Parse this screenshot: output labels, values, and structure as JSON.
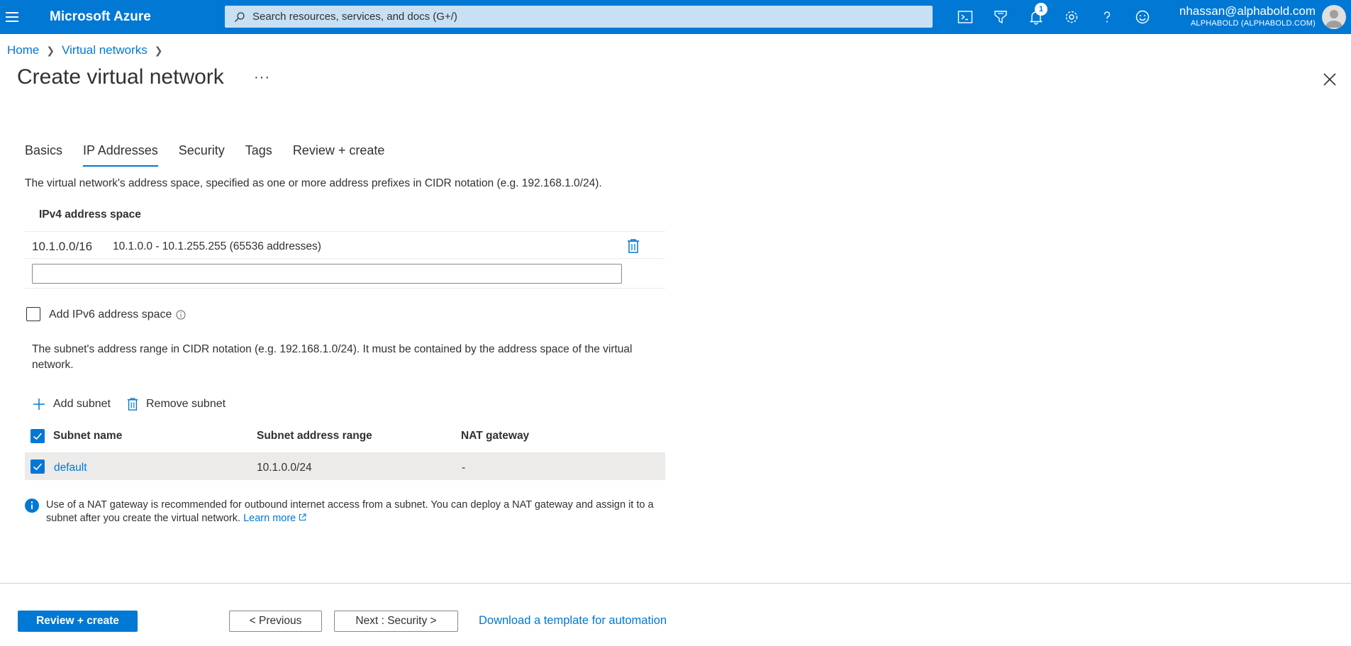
{
  "topbar": {
    "brand": "Microsoft Azure",
    "search_placeholder": "Search resources, services, and docs (G+/)",
    "notification_count": "1",
    "user_email": "nhassan@alphabold.com",
    "tenant": "ALPHABOLD (ALPHABOLD.COM)",
    "icons": [
      "cloud-shell-icon",
      "directory-filter-icon",
      "bell-icon",
      "gear-icon",
      "help-icon",
      "feedback-icon"
    ]
  },
  "breadcrumb": [
    "Home",
    "Virtual networks"
  ],
  "page": {
    "title": "Create virtual network",
    "ellipsis": "···"
  },
  "tabs": [
    "Basics",
    "IP Addresses",
    "Security",
    "Tags",
    "Review + create"
  ],
  "active_tab": "IP Addresses",
  "ip_addresses": {
    "description": "The virtual network's address space, specified as one or more address prefixes in CIDR notation (e.g. 192.168.1.0/24).",
    "ipv4_header": "IPv4 address space",
    "prefix": "10.1.0.0/16",
    "range": "10.1.0.0 - 10.1.255.255 (65536 addresses)",
    "new_prefix_value": "",
    "ipv6_label": "Add IPv6 address space",
    "ipv6_checked": false,
    "subnet_description": "The subnet's address range in CIDR notation (e.g. 192.168.1.0/24). It must be contained by the address space of the virtual network.",
    "add_subnet": "Add subnet",
    "remove_subnet": "Remove subnet",
    "table": {
      "headers": [
        "Subnet name",
        "Subnet address range",
        "NAT gateway"
      ],
      "rows": [
        {
          "name": "default",
          "range": "10.1.0.0/24",
          "nat": "-",
          "checked": true
        }
      ]
    },
    "info_text": "Use of a NAT gateway is recommended for outbound internet access from a subnet. You can deploy a NAT gateway and assign it to a subnet after you create the virtual network.",
    "learn_more": "Learn more"
  },
  "footer": {
    "review_create": "Review + create",
    "previous": "< Previous",
    "next": "Next : Security >",
    "download": "Download a template for automation"
  },
  "colors": {
    "accent": "#0078d4",
    "search_bg": "#c7e0f4",
    "row_selected": "#edebe9"
  }
}
